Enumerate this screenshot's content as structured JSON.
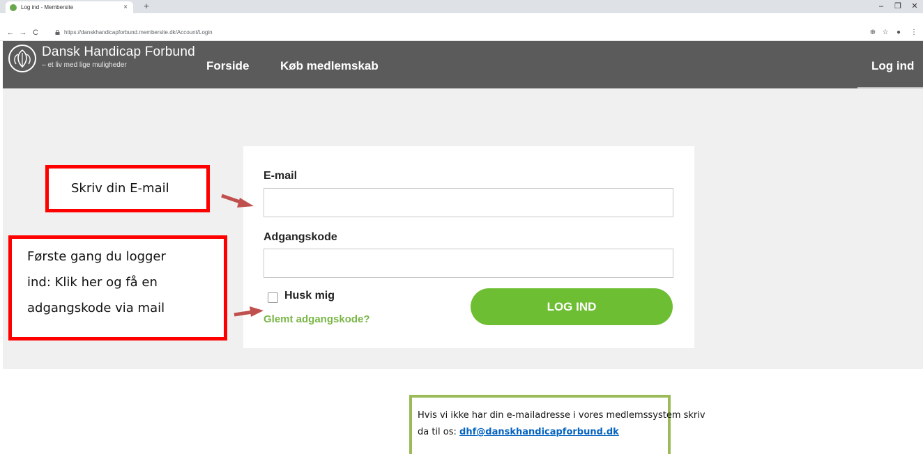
{
  "browser": {
    "tab_title": "Log ind - Membersite",
    "tab_close": "×",
    "new_tab": "+",
    "url": "https://danskhandicapforbund.membersite.dk/Account/Login",
    "back": "←",
    "forward": "→",
    "reload": "C",
    "zoom_icon": "⊕",
    "star_icon": "☆",
    "profile_icon": "●",
    "menu_icon": "⋮",
    "minimize": "–",
    "maximize": "❐",
    "close": "✕"
  },
  "header": {
    "brand": "Dansk Handicap Forbund",
    "tagline": "– et liv med lige muligheder",
    "nav": [
      {
        "label": "Forside"
      },
      {
        "label": "Køb medlemskab"
      }
    ],
    "login_label": "Log ind"
  },
  "form": {
    "email_label": "E-mail",
    "email_value": "",
    "password_label": "Adgangskode",
    "password_value": "",
    "remember_label": "Husk mig",
    "remember_checked": false,
    "forgot_label": "Glemt adgangskode?",
    "submit_label": "LOG IND"
  },
  "annotations": {
    "email_hint": "Skriv din E-mail",
    "first_time_lines": [
      "Første gang du logger",
      "ind: Klik her og få en",
      "adgangskode via mail"
    ],
    "info_line1": "Hvis vi ikke har din e-mailadresse i vores medlemssystem skriv",
    "info_line2_prefix": "da til os: ",
    "info_email": "dhf@danskhandicapforbund.dk"
  },
  "colors": {
    "header_bg": "#5b5b5b",
    "accent_green": "#6ebe33",
    "callout_red": "#ff0000",
    "info_border": "#9bbb59",
    "link_blue": "#0563c1"
  }
}
